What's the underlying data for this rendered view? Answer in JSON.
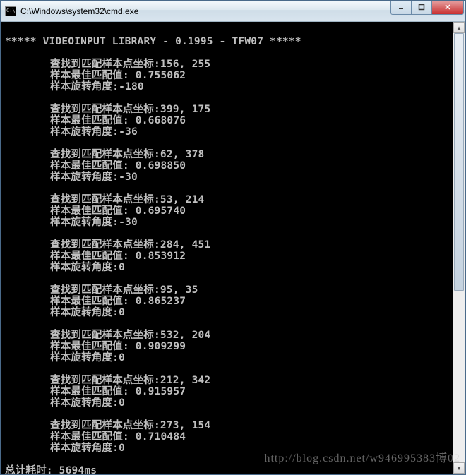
{
  "window": {
    "title": "C:\\Windows\\system32\\cmd.exe"
  },
  "console": {
    "header": "***** VIDEOINPUT LIBRARY - 0.1995 - TFW07 *****",
    "label_coord": "查找到匹配样本点坐标:",
    "label_match": "样本最佳匹配值: ",
    "label_angle": "样本旋转角度:",
    "blocks": [
      {
        "coord": "156, 255",
        "match": "0.755062",
        "angle": "-180"
      },
      {
        "coord": "399, 175",
        "match": "0.668076",
        "angle": "-36"
      },
      {
        "coord": "62, 378",
        "match": "0.698850",
        "angle": "-30"
      },
      {
        "coord": "53, 214",
        "match": "0.695740",
        "angle": "-30"
      },
      {
        "coord": "284, 451",
        "match": "0.853912",
        "angle": "0"
      },
      {
        "coord": "95, 35",
        "match": "0.865237",
        "angle": "0"
      },
      {
        "coord": "532, 204",
        "match": "0.909299",
        "angle": "0"
      },
      {
        "coord": "212, 342",
        "match": "0.915957",
        "angle": "0"
      },
      {
        "coord": "273, 154",
        "match": "0.710484",
        "angle": "0"
      }
    ],
    "total_label": "总计耗时: ",
    "total_value": "5694ms"
  },
  "watermark": "http://blog.csdn.net/w946995383博02"
}
